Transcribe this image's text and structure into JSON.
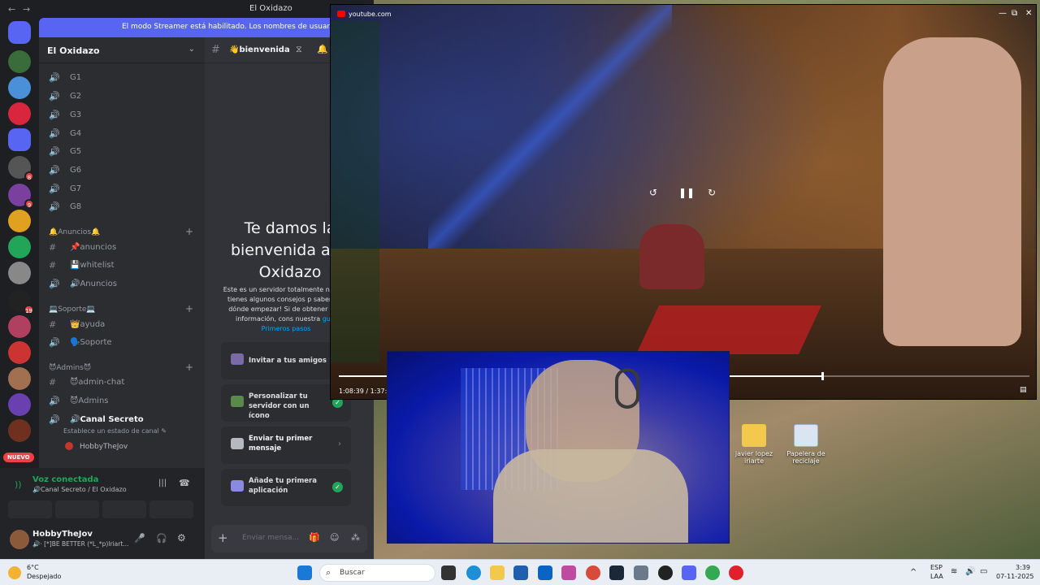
{
  "window": {
    "title": "El Oxidazo",
    "back": "←",
    "forward": "→"
  },
  "banner": {
    "text": "El modo Streamer está habilitado. Los nombres de usuario se ha"
  },
  "guilds": {
    "badges": [
      "8",
      "9",
      "19"
    ],
    "new_label": "NUEVO"
  },
  "server": {
    "name": "El Oxidazo",
    "chevron": "⌄",
    "voice_channels": [
      "G1",
      "G2",
      "G3",
      "G4",
      "G5",
      "G6",
      "G7",
      "G8"
    ],
    "categories": [
      {
        "name": "🔔Anuncios🔔",
        "channels": [
          "📌anuncios",
          "💾whitelist",
          "🔊Anuncios"
        ]
      },
      {
        "name": "💻Soporte💻",
        "channels": [
          "👑ayuda",
          "🗣️Soporte"
        ]
      },
      {
        "name": "😈Admins😈",
        "channels": [
          "😈admin-chat",
          "😈Admins"
        ]
      }
    ],
    "secret": {
      "name": "🔊Canal Secreto",
      "status_hint": "Establece un estado de canal ✎",
      "member": "HobbyTheJov"
    }
  },
  "voice": {
    "status": "Voz conectada",
    "location": "🔊Canal Secreto / El Oxidazo"
  },
  "user": {
    "name": "HobbyTheJov",
    "status": "🔊· [*]BE BETTER (*L_*p)Iriart..."
  },
  "chat": {
    "channel": "👋bienvenida",
    "welcome_title": "Te damos la bienvenida a El Oxidazo",
    "welcome_desc": "Este es un servidor totalmente n ¡Aquí tienes algunos consejos p saber por dónde empezar! Si de obtener más información, cons nuestra",
    "welcome_link": "guía Primeros pasos",
    "cards": [
      {
        "label": "Invitar a tus amigos",
        "done": false
      },
      {
        "label": "Personalizar tu servidor con un ícono",
        "done": true
      },
      {
        "label": "Enviar tu primer mensaje",
        "done": false
      },
      {
        "label": "Añade tu primera aplicación",
        "done": true
      }
    ],
    "input_placeholder": "Enviar mensa..."
  },
  "youtube": {
    "url": "youtube.com",
    "time": "1:08:39 / 1:37:57",
    "progress": 0.7,
    "window_controls": [
      "—",
      "⧉",
      "✕"
    ]
  },
  "desktop": {
    "icons": [
      "javier lopez iriarte",
      "Papelera de reciclaje"
    ]
  },
  "taskbar": {
    "weather_temp": "6°C",
    "weather_desc": "Despejado",
    "search_placeholder": "Buscar",
    "lang": "ESP",
    "lang_sub": "LAA",
    "time": "3:39",
    "date": "07-11-2025"
  },
  "colors": {
    "discord_bg": "#1e1f22",
    "sidebar": "#2b2d31",
    "chat_bg": "#313338",
    "blurple": "#5865f2",
    "green": "#23a559",
    "red": "#f23f43",
    "taskbar": "#e9eef5"
  }
}
